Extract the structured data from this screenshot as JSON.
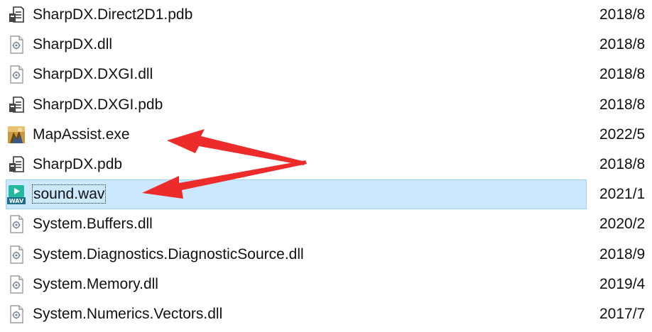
{
  "files": [
    {
      "name": "SharpDX.Direct2D1.pdb",
      "date": "2018/8",
      "icon": "pdb-file-icon"
    },
    {
      "name": "SharpDX.dll",
      "date": "2018/8",
      "icon": "dll-file-icon"
    },
    {
      "name": "SharpDX.DXGI.dll",
      "date": "2018/8",
      "icon": "dll-file-icon"
    },
    {
      "name": "SharpDX.DXGI.pdb",
      "date": "2018/8",
      "icon": "pdb-file-icon"
    },
    {
      "name": "MapAssist.exe",
      "date": "2022/5",
      "icon": "exe-app-icon"
    },
    {
      "name": "SharpDX.pdb",
      "date": "2018/8",
      "icon": "pdb-file-icon"
    },
    {
      "name": "sound.wav",
      "date": "2021/1",
      "icon": "wav-audio-icon",
      "selected": true
    },
    {
      "name": "System.Buffers.dll",
      "date": "2020/2",
      "icon": "dll-file-icon"
    },
    {
      "name": "System.Diagnostics.DiagnosticSource.dll",
      "date": "2018/9",
      "icon": "dll-file-icon"
    },
    {
      "name": "System.Memory.dll",
      "date": "2019/4",
      "icon": "dll-file-icon"
    },
    {
      "name": "System.Numerics.Vectors.dll",
      "date": "2017/7",
      "icon": "dll-file-icon"
    }
  ],
  "colors": {
    "selection_fill": "#cce8ff",
    "selection_border": "#99d1ff",
    "arrow": "#ee2b2b"
  }
}
